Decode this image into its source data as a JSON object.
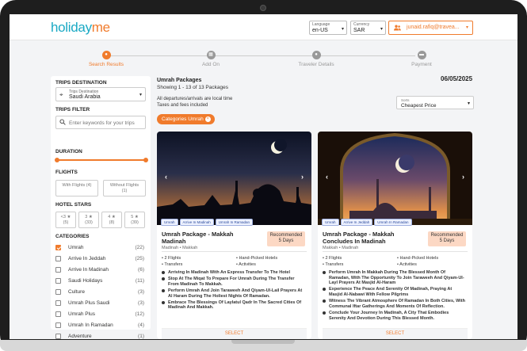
{
  "header": {
    "logo_left": "holiday",
    "logo_right": "me",
    "language_label": "Language",
    "language_value": "en-US",
    "currency_label": "Currency",
    "currency_value": "SAR",
    "user_email": "junaid.rafiq@travea..."
  },
  "stepper": [
    {
      "label": "Search Results",
      "active": true
    },
    {
      "label": "Add On",
      "active": false
    },
    {
      "label": "Traveler Details",
      "active": false
    },
    {
      "label": "Payment",
      "active": false
    }
  ],
  "sidebar": {
    "destination_title": "TRIPS DESTINATION",
    "destination_label": "Trips Destination",
    "destination_value": "Saudi Arabia",
    "filter_title": "TRIPS FILTER",
    "keyword_placeholder": "Enter keywords for your trips",
    "duration_title": "DURATION",
    "flights_title": "FLIGHTS",
    "flight_options": [
      {
        "label": "With Flights",
        "count": "(4)"
      },
      {
        "label": "Without Flights",
        "count": "(1)"
      }
    ],
    "stars_title": "HOTEL STARS",
    "star_options": [
      {
        "label": "<3",
        "count": "(5)"
      },
      {
        "label": "3",
        "count": "(33)"
      },
      {
        "label": "4",
        "count": "(8)"
      },
      {
        "label": "5",
        "count": "(39)"
      }
    ],
    "categories_title": "CATEGORIES",
    "categories": [
      {
        "name": "Umrah",
        "count": "(22)",
        "checked": true
      },
      {
        "name": "Arrive In Jeddah",
        "count": "(25)",
        "checked": false
      },
      {
        "name": "Arrive In Madinah",
        "count": "(6)",
        "checked": false
      },
      {
        "name": "Saudi Holidays",
        "count": "(11)",
        "checked": false
      },
      {
        "name": "Culture",
        "count": "(3)",
        "checked": false
      },
      {
        "name": "Umrah Plus Saudi",
        "count": "(3)",
        "checked": false
      },
      {
        "name": "Umrah Plus",
        "count": "(12)",
        "checked": false
      },
      {
        "name": "Umrah In Ramadan",
        "count": "(4)",
        "checked": false
      },
      {
        "name": "Adventure",
        "count": "(1)",
        "checked": false
      }
    ]
  },
  "main": {
    "title": "Umrah Packages",
    "subtitle": "Showing 1 - 13 of 13 Packages",
    "date": "06/05/2025",
    "info_line1": "All departures/arrivals are local time",
    "info_line2": "Taxes and fees included",
    "sort_label": "Sorts",
    "sort_value": "Cheapest Price",
    "filter_chip": "Categories Umrah",
    "select_label": "SELECT"
  },
  "cards": [
    {
      "title": "Umrah Package - Makkah Madinah",
      "destinations": "Madinah  •  Makkah",
      "recommended": "Recommended",
      "duration": "5 Days",
      "tags": [
        "Umrah",
        "Arrive In Madinah",
        "Umrah In Ramadan"
      ],
      "features": [
        "2 Flights",
        "Hand-Picked Hotels",
        "Transfers",
        "Activities"
      ],
      "highlights": [
        "Arriving In Madinah With An Express Transfer To The Hotel",
        "Stop At The Miqat To Prepare For Umrah During The Transfer From Madinah To Makkah.",
        "Perform Umrah And Join Taraweeh And Qiyam-Ul-Lail Prayers At Al Haram During The Holiest Nights Of Ramadan.",
        "Embrace The Blessings Of Laylatul Qadr In The Sacred Cities Of Madinah And Makkah."
      ]
    },
    {
      "title": "Umrah Package - Makkah Concludes In Madinah",
      "destinations": "Makkah  •  Madinah",
      "recommended": "Recommended",
      "duration": "5 Days",
      "tags": [
        "Umrah",
        "Arrive In Jeddah",
        "Umrah In Ramadan"
      ],
      "features": [
        "2 Flights",
        "Hand-Picked Hotels",
        "Transfers",
        "Activities"
      ],
      "highlights": [
        "Perform Umrah In Makkah During The Blessed Month Of Ramadan, With The Opportunity To Join Taraweeh And Qiyam-Ul-Layl Prayers At Masjid Al-Haram",
        "Experience The Peace And Serenity Of Madinah, Praying At Masjid Al-Nabawi With Fellow Pilgrims",
        "Witness The Vibrant Atmosphere Of Ramadan In Both Cities, With Communal Iftar Gatherings And Moments Of Reflection.",
        "Conclude Your Journey In Madinah, A City That Embodies Serenity And Devotion During This Blessed Month."
      ]
    }
  ]
}
